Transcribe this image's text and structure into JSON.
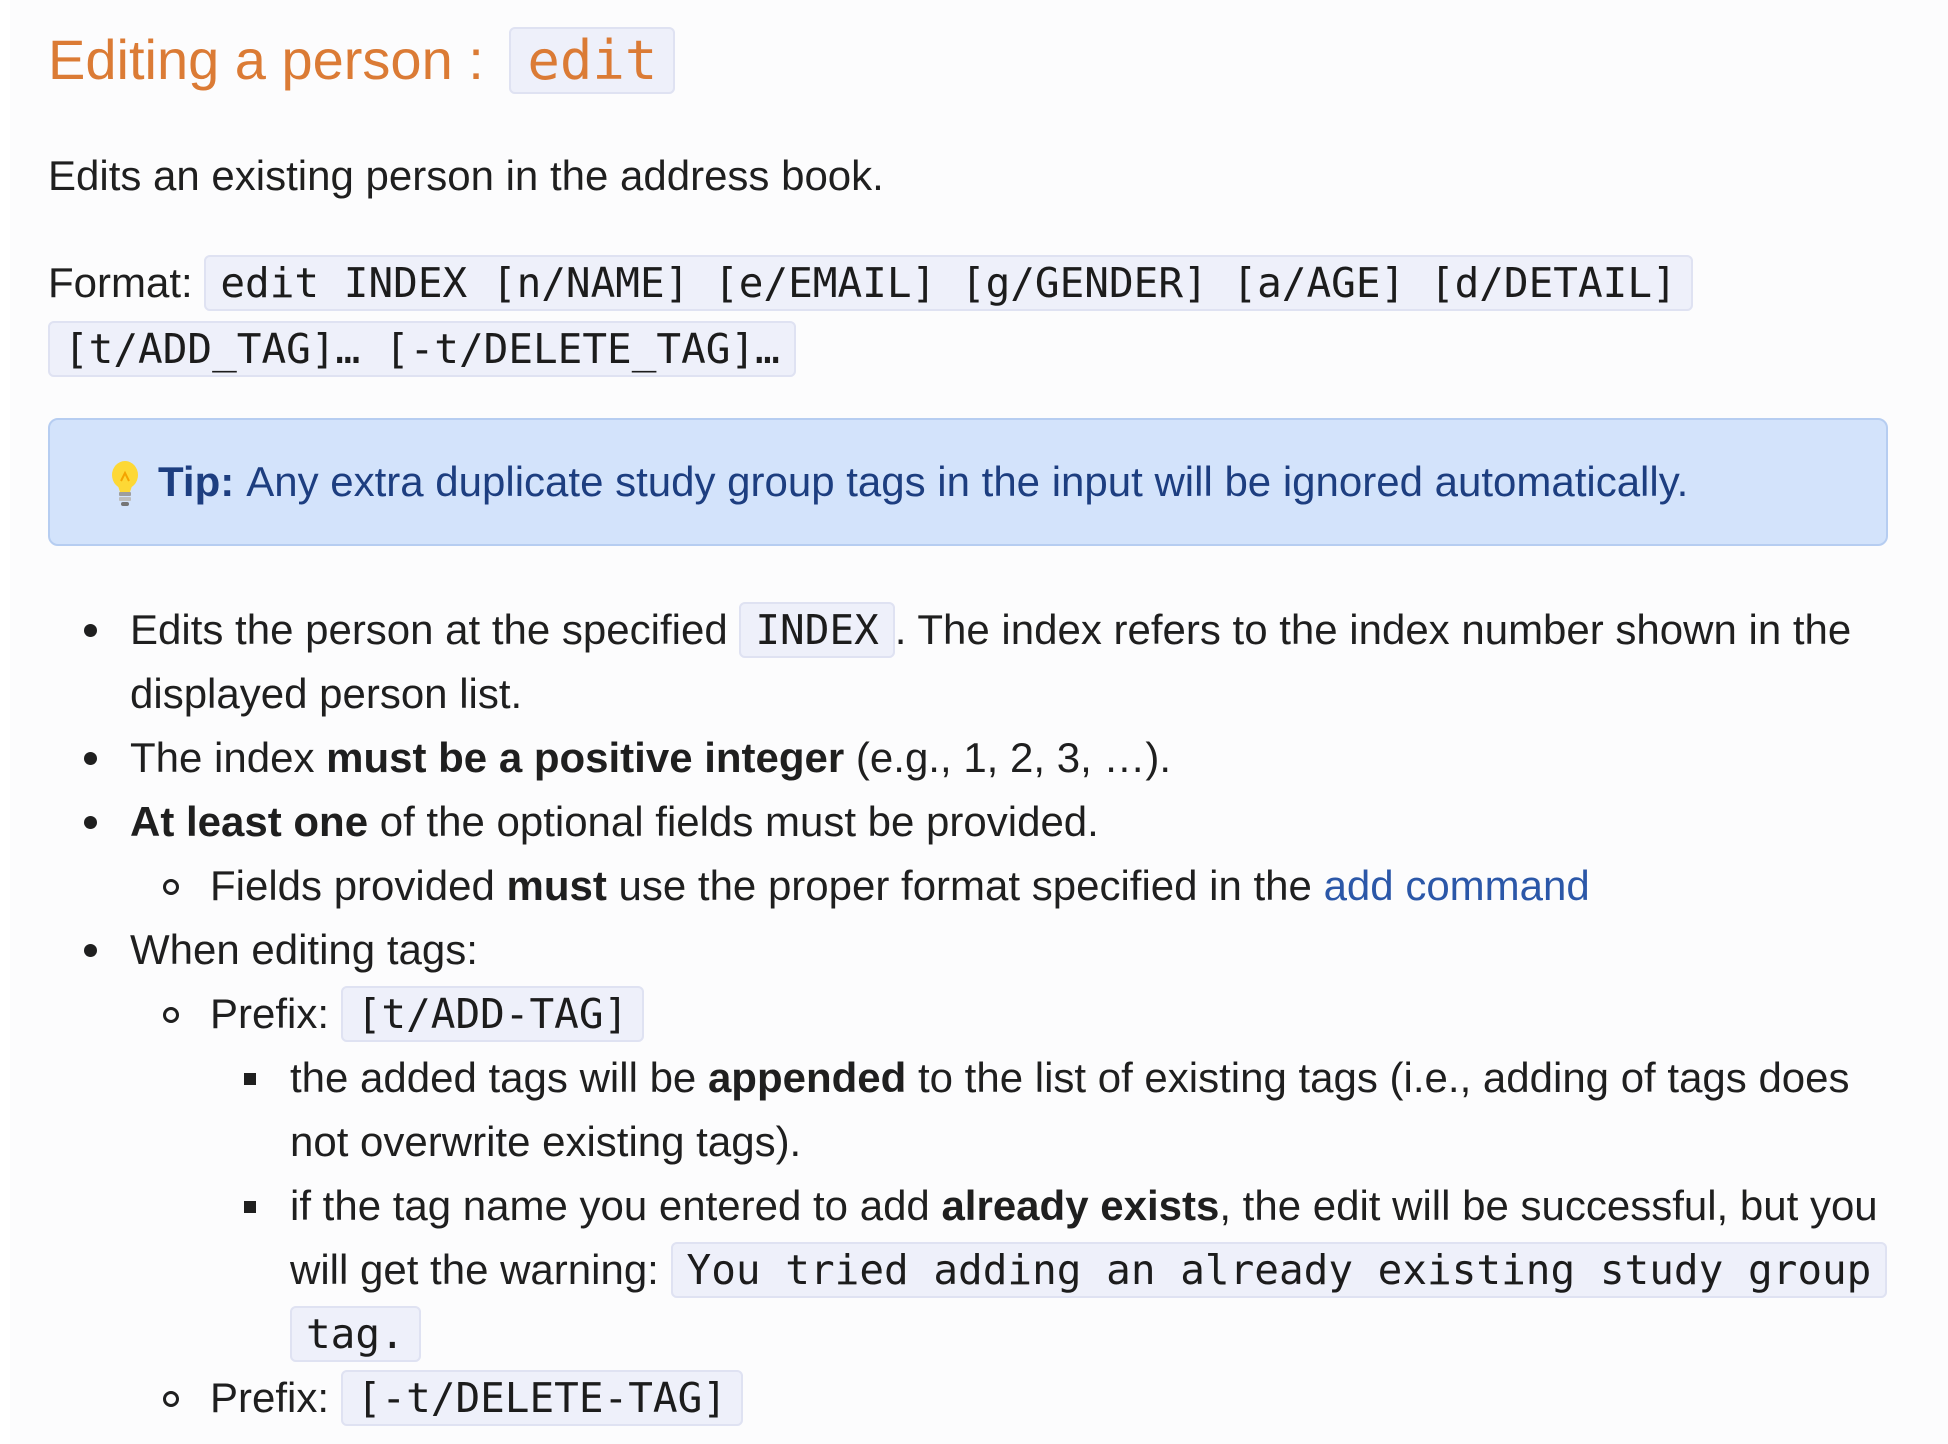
{
  "heading": {
    "text": "Editing a person : ",
    "code": "edit"
  },
  "intro": "Edits an existing person in the address book.",
  "format": {
    "label": "Format: ",
    "line1": "edit INDEX [n/NAME] [e/EMAIL] [g/GENDER] [a/AGE] [d/DETAIL]",
    "line2": "[t/ADD_TAG]… [-t/DELETE_TAG]…"
  },
  "tip": {
    "icon": "lightbulb-icon",
    "label": "Tip:",
    "text": "Any extra duplicate study group tags in the input will be ignored automatically."
  },
  "bullets": {
    "b1": {
      "pre": "Edits the person at the specified ",
      "code": "INDEX",
      "post": ". The index refers to the index number shown in the displayed person list."
    },
    "b2": {
      "pre": "The index ",
      "bold": "must be a positive integer",
      "post": " (e.g., 1, 2, 3, …)."
    },
    "b3": {
      "bold": "At least one",
      "post": " of the optional fields must be provided.",
      "sub": {
        "pre": "Fields provided ",
        "bold": "must",
        "mid": " use the proper format specified in the ",
        "link": "add command"
      }
    },
    "b4": {
      "text": "When editing tags:",
      "add": {
        "label": "Prefix: ",
        "code": "[t/ADD-TAG]",
        "items": {
          "i1": {
            "pre": "the added tags will be ",
            "bold": "appended",
            "post": " to the list of existing tags (i.e., adding of tags does not overwrite existing tags)."
          },
          "i2": {
            "pre": "if the tag name you entered to add ",
            "bold": "already exists",
            "mid": ", the edit will be successful, but you will get the warning: ",
            "code": "You tried adding an already existing study group tag."
          }
        }
      },
      "delete": {
        "label": "Prefix: ",
        "code": "[-t/DELETE-TAG]"
      }
    }
  },
  "colors": {
    "heading": "#db7b35",
    "tip_background": "#d3e3fb",
    "tip_text": "#1d3e80",
    "link": "#2b57a8",
    "code_background": "#eef0fa"
  }
}
